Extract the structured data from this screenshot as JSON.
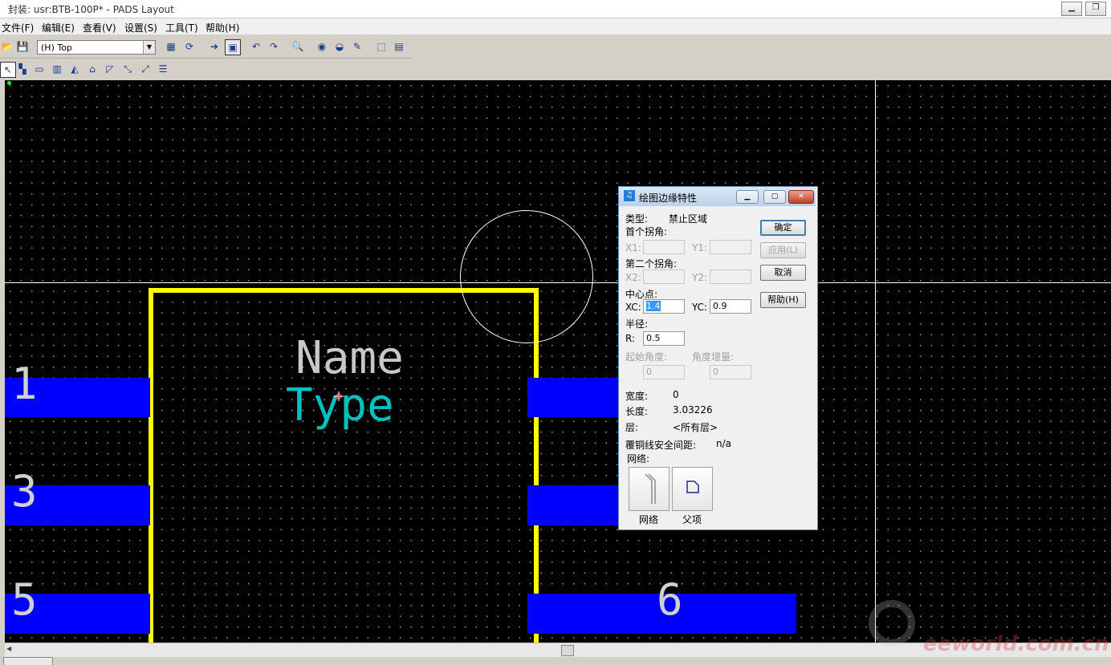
{
  "window": {
    "title": "封装: usr:BTB-100P* - PADS Layout",
    "minimize_icon": "minimize-icon",
    "restore_icon": "restore-icon"
  },
  "menu": [
    "文件(F)",
    "编辑(E)",
    "查看(V)",
    "设置(S)",
    "工具(T)",
    "帮助(H)"
  ],
  "toolbar": {
    "layer_value": "(H) Top"
  },
  "canvas": {
    "colors": {
      "background": "#000000",
      "outline": "#ffff00",
      "pad": "#0000ff",
      "type_text": "#00c0c0",
      "grid": "#8a8a8a"
    },
    "labels": {
      "name": "Name",
      "type": "Type"
    },
    "pins": [
      "1",
      "3",
      "5",
      "6"
    ]
  },
  "dialog": {
    "title": "绘图边缘特性",
    "type_label": "类型:",
    "type_value": "禁止区域",
    "first_corner": "首个拐角:",
    "x1": "X1:",
    "y1": "Y1:",
    "second_corner": "第二个拐角:",
    "x2": "X2:",
    "y2": "Y2:",
    "center": "中心点:",
    "xc_label": "XC:",
    "xc_value": "1.4",
    "yc_label": "YC:",
    "yc_value": "0.9",
    "radius": "半径:",
    "r_label": "R:",
    "r_value": "0.5",
    "start_angle": "起始角度:",
    "start_angle_value": "0",
    "angle_delta": "角度增量:",
    "angle_delta_value": "0",
    "width_label": "宽度:",
    "width_value": "0",
    "length_label": "长度:",
    "length_value": "3.03226",
    "layer_label": "层:",
    "layer_value": "<所有层>",
    "clearance_label": "覆铜线安全间距:",
    "clearance_value": "n/a",
    "net_label": "网络:",
    "buttons": {
      "ok": "确定",
      "apply": "应用(L)",
      "cancel": "取消",
      "help": "帮助(H)"
    },
    "net_button": "网络",
    "parent_button": "父项"
  },
  "watermark": "eeworld.com.cn"
}
